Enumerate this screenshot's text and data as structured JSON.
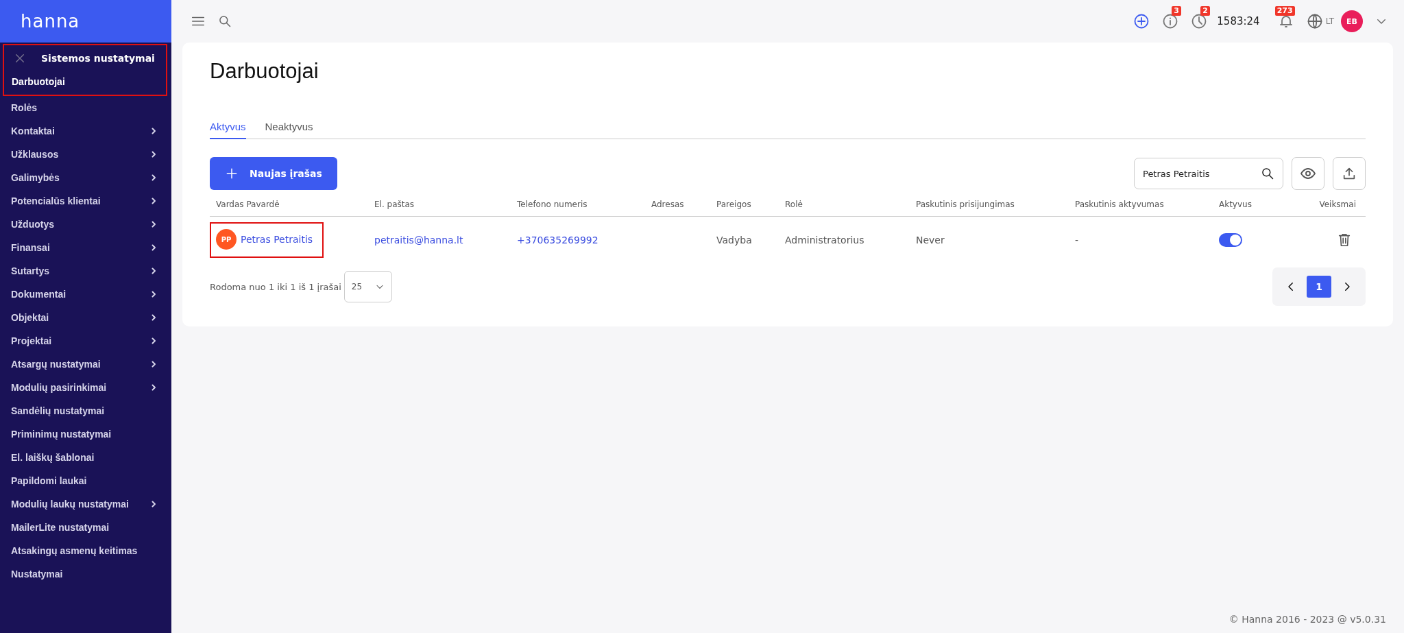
{
  "sidebar": {
    "logo": "hanna",
    "section": {
      "title": "Sistemos nustatymai",
      "highlighted": true
    },
    "items": [
      {
        "label": "Darbuotojai",
        "selected": true,
        "expandable": false
      },
      {
        "label": "Rolės",
        "selected": false,
        "expandable": false
      },
      {
        "label": "Kontaktai",
        "selected": false,
        "expandable": true
      },
      {
        "label": "Užklausos",
        "selected": false,
        "expandable": true
      },
      {
        "label": "Galimybės",
        "selected": false,
        "expandable": true
      },
      {
        "label": "Potencialūs klientai",
        "selected": false,
        "expandable": true
      },
      {
        "label": "Užduotys",
        "selected": false,
        "expandable": true
      },
      {
        "label": "Finansai",
        "selected": false,
        "expandable": true
      },
      {
        "label": "Sutartys",
        "selected": false,
        "expandable": true
      },
      {
        "label": "Dokumentai",
        "selected": false,
        "expandable": true
      },
      {
        "label": "Objektai",
        "selected": false,
        "expandable": true
      },
      {
        "label": "Projektai",
        "selected": false,
        "expandable": true
      },
      {
        "label": "Atsargų nustatymai",
        "selected": false,
        "expandable": true
      },
      {
        "label": "Modulių pasirinkimai",
        "selected": false,
        "expandable": true
      },
      {
        "label": "Sandėlių nustatymai",
        "selected": false,
        "expandable": false
      },
      {
        "label": "Priminimų nustatymai",
        "selected": false,
        "expandable": false
      },
      {
        "label": "El. laiškų šablonai",
        "selected": false,
        "expandable": false
      },
      {
        "label": "Papildomi laukai",
        "selected": false,
        "expandable": false
      },
      {
        "label": "Modulių laukų nustatymai",
        "selected": false,
        "expandable": true
      },
      {
        "label": "MailerLite nustatymai",
        "selected": false,
        "expandable": false
      },
      {
        "label": "Atsakingų asmenų keitimas",
        "selected": false,
        "expandable": false
      },
      {
        "label": "Nustatymai",
        "selected": false,
        "expandable": false
      }
    ]
  },
  "topbar": {
    "info_count": "3",
    "clock_count": "2",
    "time": "1583:24",
    "notification_count": "273",
    "language": "LT",
    "avatar": "EB"
  },
  "page": {
    "title": "Darbuotojai",
    "tabs": [
      {
        "label": "Aktyvus",
        "selected": true
      },
      {
        "label": "Neaktyvus",
        "selected": false
      }
    ],
    "new_button": "Naujas įrašas",
    "search": {
      "value": "Petras Petraitis"
    }
  },
  "table": {
    "columns": [
      "Vardas Pavardė",
      "El. paštas",
      "Telefono numeris",
      "Adresas",
      "Pareigos",
      "Rolė",
      "Paskutinis prisijungimas",
      "Paskutinis aktyvumas",
      "Aktyvus",
      "Veiksmai"
    ],
    "rows": [
      {
        "avatar": "PP",
        "name": "Petras Petraitis",
        "highlighted": true,
        "email": "petraitis@hanna.lt",
        "phone": "+370635269992",
        "duties": "Vadyba",
        "role": "Administratorius",
        "last_login": "Never",
        "last_activity": "-",
        "active": true
      }
    ]
  },
  "footer": {
    "summary": "Rodoma nuo 1 iki 1 iš 1 įrašai",
    "page_size": "25",
    "pages": [
      {
        "label": "1",
        "selected": true
      }
    ]
  },
  "copyright": "© Hanna 2016 - 2023 @ v5.0.31"
}
